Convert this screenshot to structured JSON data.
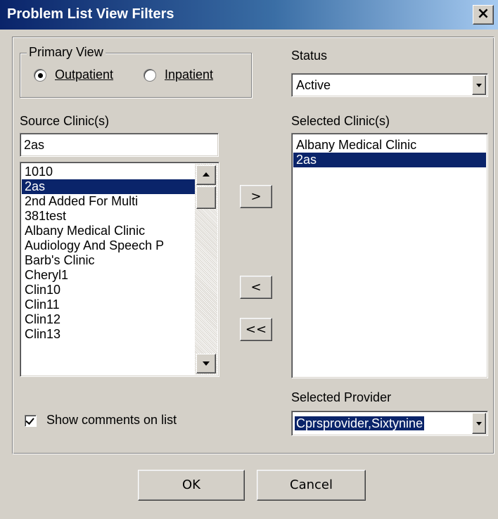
{
  "window": {
    "title": "Problem List View Filters",
    "close_glyph": "×"
  },
  "primary_view": {
    "label": "Primary View",
    "options": [
      {
        "label": "Outpatient",
        "selected": true
      },
      {
        "label": "Inpatient",
        "selected": false
      }
    ]
  },
  "status": {
    "label": "Status",
    "value": "Active"
  },
  "source_clinics": {
    "label": "Source Clinic(s)",
    "search_value": "2as",
    "items": [
      "1010",
      "2as",
      "2nd Added For Multi",
      "381test",
      "Albany Medical Clinic",
      "Audiology And Speech P",
      "Barb's Clinic",
      "Cheryl1",
      "Clin10",
      "Clin11",
      "Clin12",
      "Clin13"
    ],
    "selected_index": 1
  },
  "selected_clinics": {
    "label": "Selected Clinic(s)",
    "items": [
      "Albany Medical Clinic",
      "2as"
    ],
    "selected_index": 1
  },
  "transfer_buttons": {
    "add": ">",
    "remove": "<",
    "remove_all": "<<"
  },
  "selected_provider": {
    "label": "Selected Provider",
    "value": "Cprsprovider,Sixtynine"
  },
  "show_comments": {
    "label": "Show comments on list",
    "checked": true
  },
  "footer": {
    "ok_label": "OK",
    "cancel_label": "Cancel"
  },
  "colors": {
    "title_bar": "#0a246a",
    "selection": "#0a246a",
    "face": "#d4d0c8"
  }
}
